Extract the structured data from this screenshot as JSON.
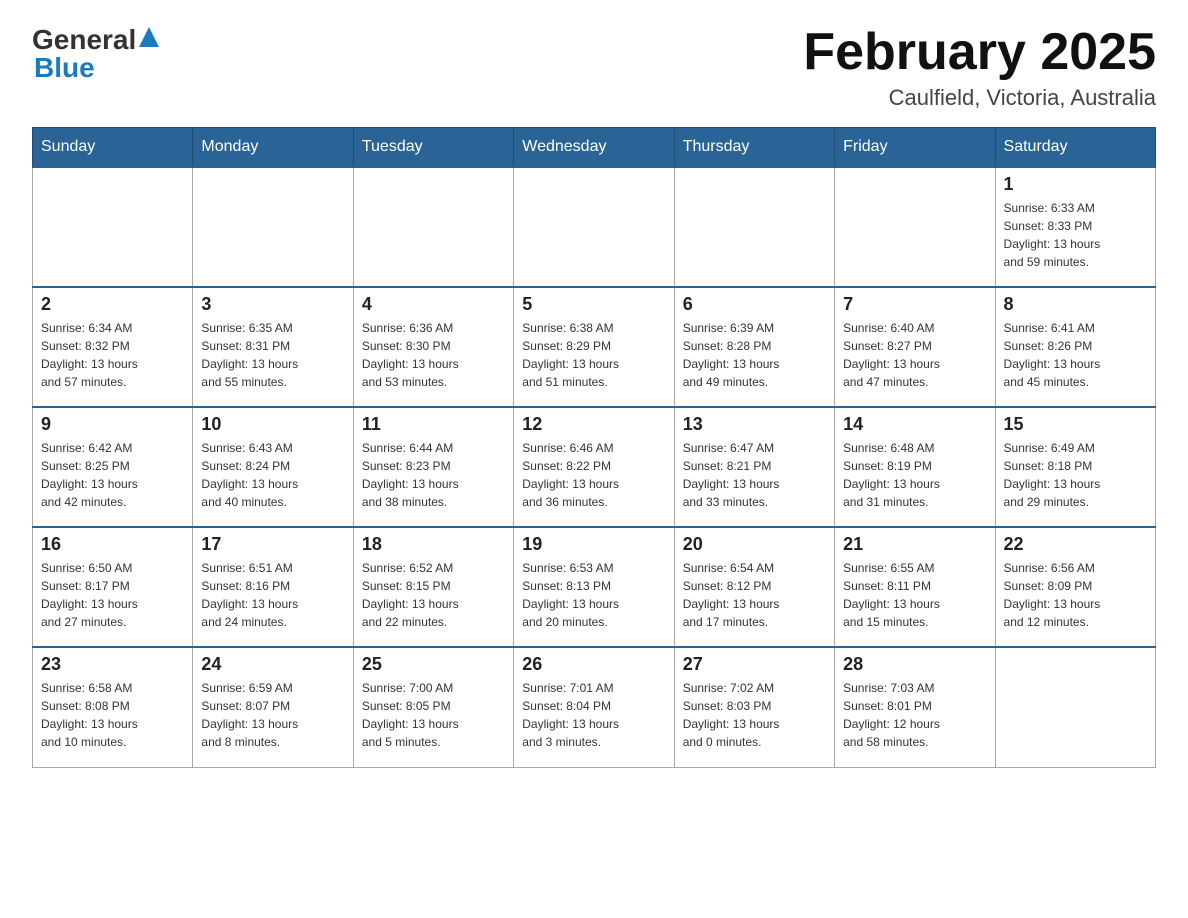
{
  "logo": {
    "general": "General",
    "blue": "Blue",
    "triangle": "▲"
  },
  "header": {
    "month_title": "February 2025",
    "location": "Caulfield, Victoria, Australia"
  },
  "weekdays": [
    "Sunday",
    "Monday",
    "Tuesday",
    "Wednesday",
    "Thursday",
    "Friday",
    "Saturday"
  ],
  "weeks": [
    [
      {
        "day": "",
        "info": ""
      },
      {
        "day": "",
        "info": ""
      },
      {
        "day": "",
        "info": ""
      },
      {
        "day": "",
        "info": ""
      },
      {
        "day": "",
        "info": ""
      },
      {
        "day": "",
        "info": ""
      },
      {
        "day": "1",
        "info": "Sunrise: 6:33 AM\nSunset: 8:33 PM\nDaylight: 13 hours\nand 59 minutes."
      }
    ],
    [
      {
        "day": "2",
        "info": "Sunrise: 6:34 AM\nSunset: 8:32 PM\nDaylight: 13 hours\nand 57 minutes."
      },
      {
        "day": "3",
        "info": "Sunrise: 6:35 AM\nSunset: 8:31 PM\nDaylight: 13 hours\nand 55 minutes."
      },
      {
        "day": "4",
        "info": "Sunrise: 6:36 AM\nSunset: 8:30 PM\nDaylight: 13 hours\nand 53 minutes."
      },
      {
        "day": "5",
        "info": "Sunrise: 6:38 AM\nSunset: 8:29 PM\nDaylight: 13 hours\nand 51 minutes."
      },
      {
        "day": "6",
        "info": "Sunrise: 6:39 AM\nSunset: 8:28 PM\nDaylight: 13 hours\nand 49 minutes."
      },
      {
        "day": "7",
        "info": "Sunrise: 6:40 AM\nSunset: 8:27 PM\nDaylight: 13 hours\nand 47 minutes."
      },
      {
        "day": "8",
        "info": "Sunrise: 6:41 AM\nSunset: 8:26 PM\nDaylight: 13 hours\nand 45 minutes."
      }
    ],
    [
      {
        "day": "9",
        "info": "Sunrise: 6:42 AM\nSunset: 8:25 PM\nDaylight: 13 hours\nand 42 minutes."
      },
      {
        "day": "10",
        "info": "Sunrise: 6:43 AM\nSunset: 8:24 PM\nDaylight: 13 hours\nand 40 minutes."
      },
      {
        "day": "11",
        "info": "Sunrise: 6:44 AM\nSunset: 8:23 PM\nDaylight: 13 hours\nand 38 minutes."
      },
      {
        "day": "12",
        "info": "Sunrise: 6:46 AM\nSunset: 8:22 PM\nDaylight: 13 hours\nand 36 minutes."
      },
      {
        "day": "13",
        "info": "Sunrise: 6:47 AM\nSunset: 8:21 PM\nDaylight: 13 hours\nand 33 minutes."
      },
      {
        "day": "14",
        "info": "Sunrise: 6:48 AM\nSunset: 8:19 PM\nDaylight: 13 hours\nand 31 minutes."
      },
      {
        "day": "15",
        "info": "Sunrise: 6:49 AM\nSunset: 8:18 PM\nDaylight: 13 hours\nand 29 minutes."
      }
    ],
    [
      {
        "day": "16",
        "info": "Sunrise: 6:50 AM\nSunset: 8:17 PM\nDaylight: 13 hours\nand 27 minutes."
      },
      {
        "day": "17",
        "info": "Sunrise: 6:51 AM\nSunset: 8:16 PM\nDaylight: 13 hours\nand 24 minutes."
      },
      {
        "day": "18",
        "info": "Sunrise: 6:52 AM\nSunset: 8:15 PM\nDaylight: 13 hours\nand 22 minutes."
      },
      {
        "day": "19",
        "info": "Sunrise: 6:53 AM\nSunset: 8:13 PM\nDaylight: 13 hours\nand 20 minutes."
      },
      {
        "day": "20",
        "info": "Sunrise: 6:54 AM\nSunset: 8:12 PM\nDaylight: 13 hours\nand 17 minutes."
      },
      {
        "day": "21",
        "info": "Sunrise: 6:55 AM\nSunset: 8:11 PM\nDaylight: 13 hours\nand 15 minutes."
      },
      {
        "day": "22",
        "info": "Sunrise: 6:56 AM\nSunset: 8:09 PM\nDaylight: 13 hours\nand 12 minutes."
      }
    ],
    [
      {
        "day": "23",
        "info": "Sunrise: 6:58 AM\nSunset: 8:08 PM\nDaylight: 13 hours\nand 10 minutes."
      },
      {
        "day": "24",
        "info": "Sunrise: 6:59 AM\nSunset: 8:07 PM\nDaylight: 13 hours\nand 8 minutes."
      },
      {
        "day": "25",
        "info": "Sunrise: 7:00 AM\nSunset: 8:05 PM\nDaylight: 13 hours\nand 5 minutes."
      },
      {
        "day": "26",
        "info": "Sunrise: 7:01 AM\nSunset: 8:04 PM\nDaylight: 13 hours\nand 3 minutes."
      },
      {
        "day": "27",
        "info": "Sunrise: 7:02 AM\nSunset: 8:03 PM\nDaylight: 13 hours\nand 0 minutes."
      },
      {
        "day": "28",
        "info": "Sunrise: 7:03 AM\nSunset: 8:01 PM\nDaylight: 12 hours\nand 58 minutes."
      },
      {
        "day": "",
        "info": ""
      }
    ]
  ]
}
